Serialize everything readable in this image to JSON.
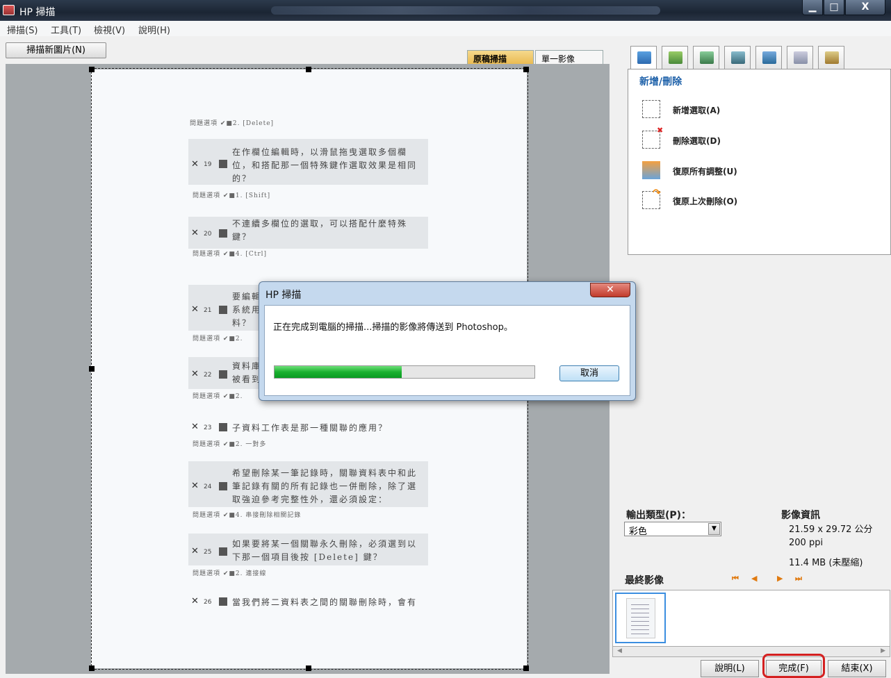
{
  "window": {
    "title": "HP 掃描",
    "minimize": "▁",
    "maximize": "□",
    "close": "X"
  },
  "menu": [
    {
      "label": "掃描(S)"
    },
    {
      "label": "工具(T)"
    },
    {
      "label": "檢視(V)"
    },
    {
      "label": "說明(H)"
    }
  ],
  "toolbar": {
    "scan_new": "掃描新圖片(N)"
  },
  "preview": {
    "tabs": {
      "original": "原稿掃描",
      "single": "單一影像"
    }
  },
  "document": {
    "lines": [
      {
        "opt": "問題選項 ✔■2. [Delete]"
      },
      {
        "num": "19",
        "text": [
          "在作欄位編輯時，以滑鼠拖曳選取多個欄",
          "位，和搭配那一個特殊鍵作選取效果是相同",
          "的？"
        ]
      },
      {
        "opt": "問題選項 ✔■1. [Shift]"
      },
      {
        "num": "20",
        "text": [
          "不連續多欄位的選取，可以搭配什麼特殊",
          "鍵？"
        ]
      },
      {
        "opt": "問題選項 ✔■4. [Ctrl]"
      },
      {
        "num": "21",
        "text": [
          "要編輯",
          "系統用",
          "料？"
        ]
      },
      {
        "opt": "問題選項 ✔■2."
      },
      {
        "num": "22",
        "text": [
          "資料庫",
          "被看到"
        ]
      },
      {
        "opt": "問題選項 ✔■2."
      },
      {
        "num": "23",
        "text": [
          "子資料工作表是那一種關聯的應用？"
        ]
      },
      {
        "opt": "問題選項 ✔■2. 一對多"
      },
      {
        "num": "24",
        "text": [
          "希望刪除某一筆記錄時，關聯資料表中和此",
          "筆記錄有關的所有記錄也一併刪除，除了選",
          "取強迫參考完整性外，還必須設定："
        ]
      },
      {
        "opt": "問題選項 ✔■4. 串接刪除相關記錄"
      },
      {
        "num": "25",
        "text": [
          "如果要將某一個關聯永久刪除，必須選到以",
          "下那一個項目後按 [Delete] 鍵？"
        ]
      },
      {
        "opt": "問題選項 ✔■2. 連接線"
      },
      {
        "num": "26",
        "text": [
          "當我們將二資料表之間的關聯刪除時，會有"
        ]
      }
    ]
  },
  "tool_panel": {
    "title": "新增/刪除",
    "items": [
      {
        "label": "新增選取(A)",
        "icon": "add-selection-icon"
      },
      {
        "label": "刪除選取(D)",
        "icon": "delete-selection-icon"
      },
      {
        "label": "復原所有調整(U)",
        "icon": "undo-all-adjustments-icon"
      },
      {
        "label": "復原上次刪除(O)",
        "icon": "undo-last-delete-icon"
      }
    ]
  },
  "output": {
    "label": "輸出類型(P)：",
    "value": "彩色"
  },
  "image_info": {
    "title": "影像資訊",
    "size": "21.59 x 29.72 公分",
    "resolution": "200 ppi",
    "filesize": "11.4 MB (未壓縮)"
  },
  "final_image": {
    "label": "最終影像"
  },
  "buttons": {
    "help": "說明(L)",
    "finish": "完成(F)",
    "exit": "結束(X)"
  },
  "dialog": {
    "title": "HP 掃描",
    "message": "正在完成到電腦的掃描...掃描的影像將傳送到 Photoshop。",
    "progress": 0.49,
    "cancel": "取消"
  },
  "colors": {
    "accent": "#1b5fa8",
    "progress": "#1ab02f",
    "highlight": "#d42020"
  }
}
